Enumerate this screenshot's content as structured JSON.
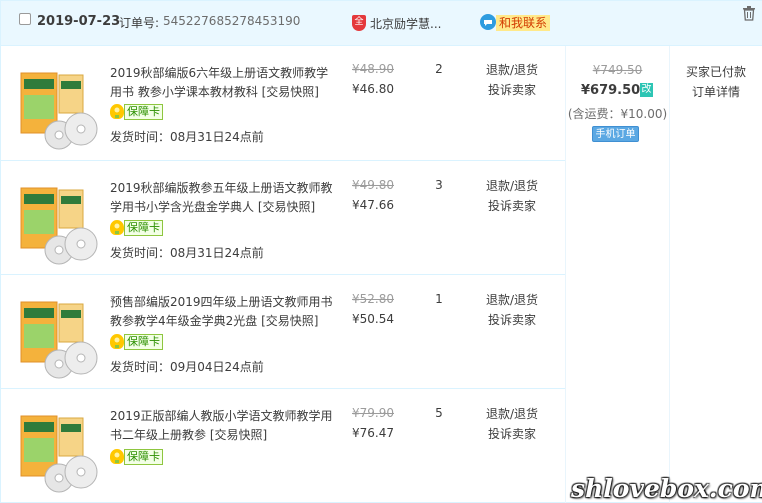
{
  "order": {
    "date": "2019-07-23",
    "order_no_label": "订单号:",
    "order_no": "545227685278453190",
    "shop_icon": "shop-badge-icon",
    "shop_icon_glyph": "全",
    "shop_name": "北京励学慧...",
    "contact_label": "和我联系",
    "contact_icon": "chat-icon"
  },
  "items": [
    {
      "title": "2019秋部编版6六年级上册语文教师教学用书 教参小学课本教材教科 [交易快照]",
      "badge": "保障卡",
      "ship": "发货时间：08月31日24点前",
      "price_old": "¥48.90",
      "price_new": "¥46.80",
      "qty": "2",
      "action1": "退款/退货",
      "action2": "投诉卖家"
    },
    {
      "title": "2019秋部编版教参五年级上册语文教师教学用书小学含光盘金学典人 [交易快照]",
      "badge": "保障卡",
      "ship": "发货时间：08月31日24点前",
      "price_old": "¥49.80",
      "price_new": "¥47.66",
      "qty": "3",
      "action1": "退款/退货",
      "action2": "投诉卖家"
    },
    {
      "title": "预售部编版2019四年级上册语文教师用书教参教学4年级金学典2光盘 [交易快照]",
      "badge": "保障卡",
      "ship": "发货时间：09月04日24点前",
      "price_old": "¥52.80",
      "price_new": "¥50.54",
      "qty": "1",
      "action1": "退款/退货",
      "action2": "投诉卖家"
    },
    {
      "title": "2019正版部编人教版小学语文教师教学用书二年级上册教参 [交易快照]",
      "badge": "保障卡",
      "ship": "",
      "price_old": "¥79.90",
      "price_new": "¥76.47",
      "qty": "5",
      "action1": "退款/退货",
      "action2": "投诉卖家"
    }
  ],
  "total": {
    "old": "¥749.50",
    "new": "¥679.50",
    "modified_tag": "改",
    "postage": "(含运费：¥10.00)",
    "mobile_order": "手机订单"
  },
  "status": {
    "text": "买家已付款",
    "detail": "订单详情"
  },
  "watermark": "shlovebox.com",
  "colors": {
    "header_bg": "#eaf8ff",
    "border": "#daf3ff",
    "accent_teal": "#2dc5b4",
    "badge_green": "#2c9000"
  }
}
